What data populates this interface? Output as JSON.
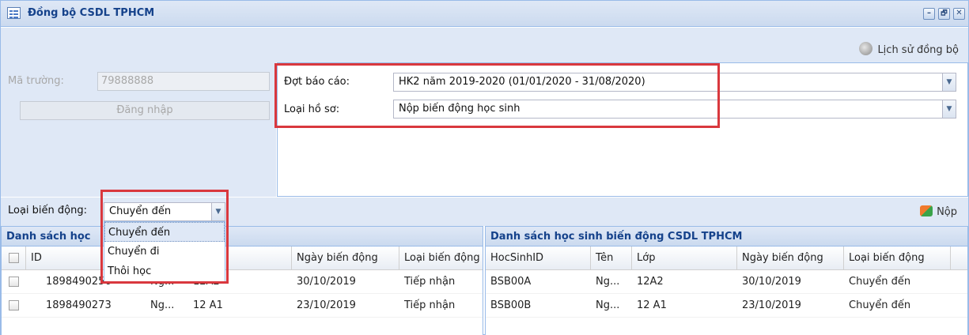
{
  "window": {
    "title": "Đồng bộ CSDL TPHCM",
    "controls": {
      "minimize": "–",
      "restore": "🗗",
      "close": "✕"
    }
  },
  "toolbar": {
    "history_label": "Lịch sử đồng bộ"
  },
  "login": {
    "school_code_label": "Mã trường:",
    "school_code_value": "79888888",
    "login_button": "Đăng nhập"
  },
  "filters": {
    "period_label": "Đợt báo cáo:",
    "period_value": "HK2 năm 2019-2020 (01/01/2020 - 31/08/2020)",
    "profile_type_label": "Loại hồ sơ:",
    "profile_type_value": "Nộp biến động học sinh"
  },
  "change_type": {
    "label": "Loại biến động:",
    "value": "Chuyển đến",
    "options": [
      "Chuyển đến",
      "Chuyển đi",
      "Thôi học"
    ]
  },
  "submit_label": "Nộp",
  "left_grid": {
    "title": "Danh sách học",
    "columns": [
      "ID",
      "",
      "",
      "Ngày biến động",
      "Loại biến động"
    ],
    "rows": [
      [
        "1898490256",
        "Ng...",
        "12A2",
        "30/10/2019",
        "Tiếp nhận"
      ],
      [
        "1898490273",
        "Ng...",
        "12 A1",
        "23/10/2019",
        "Tiếp nhận"
      ]
    ]
  },
  "right_grid": {
    "title": "Danh sách học sinh biến động CSDL TPHCM",
    "columns": [
      "HocSinhID",
      "Tên",
      "Lớp",
      "Ngày biến động",
      "Loại biến động"
    ],
    "rows": [
      [
        "BSB00A",
        "Ng...",
        "12A2",
        "30/10/2019",
        "Chuyển đến"
      ],
      [
        "BSB00B",
        "Ng...",
        "12 A1",
        "23/10/2019",
        "Chuyển đến"
      ]
    ]
  },
  "colors": {
    "header_bg": "#dfe8f6",
    "title_text": "#15428b",
    "border": "#99bbe8",
    "highlight_red": "#d9383e"
  },
  "icons": [
    "window-icon",
    "history-icon",
    "submit-icon",
    "chevron-down-icon"
  ]
}
